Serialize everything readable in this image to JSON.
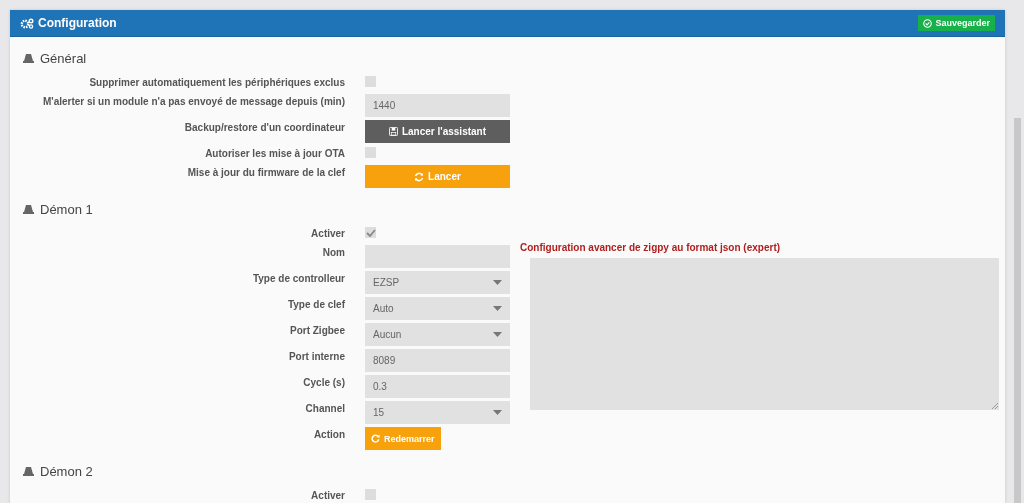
{
  "panel": {
    "title": "Configuration",
    "save_button": "Sauvegarder"
  },
  "sections": [
    {
      "title": "Général",
      "rows": [
        {
          "kind": "checkbox",
          "label": "Supprimer automatiquement les périphériques exclus",
          "checked": false
        },
        {
          "kind": "input",
          "label": "M'alerter si un module n'a pas envoyé de message depuis (min)",
          "value": "1440"
        },
        {
          "kind": "wide-button",
          "label": "Backup/restore d'un coordinateur",
          "text": "Lancer l'assistant",
          "color": "#5e5e5e"
        },
        {
          "kind": "checkbox",
          "label": "Autoriser les mise à jour OTA",
          "checked": false
        },
        {
          "kind": "wide-button",
          "label": "Mise à jour du firmware de la clef",
          "text": "Lancer",
          "color": "#f7a10c"
        }
      ]
    },
    {
      "title": "Démon 1",
      "advanced": {
        "label": "Configuration avancer de zigpy au format json (expert)"
      },
      "rows": [
        {
          "kind": "checkbox",
          "label": "Activer",
          "checked": true
        },
        {
          "kind": "input",
          "label": "Nom"
        },
        {
          "kind": "select",
          "label": "Type de controlleur",
          "value": "EZSP"
        },
        {
          "kind": "select",
          "label": "Type de clef",
          "value": "Auto"
        },
        {
          "kind": "select",
          "label": "Port Zigbee",
          "value": "Aucun"
        },
        {
          "kind": "input",
          "label": "Port interne",
          "value": "8089"
        },
        {
          "kind": "input",
          "label": "Cycle (s)",
          "value": "0.3"
        },
        {
          "kind": "select",
          "label": "Channel",
          "value": "15"
        },
        {
          "kind": "small-button",
          "label": "Action",
          "text": "Redemarrer",
          "color": "#f7a10c"
        }
      ]
    },
    {
      "title": "Démon 2",
      "rows": [
        {
          "kind": "checkbox",
          "label": "Activer",
          "checked": false
        }
      ]
    }
  ]
}
